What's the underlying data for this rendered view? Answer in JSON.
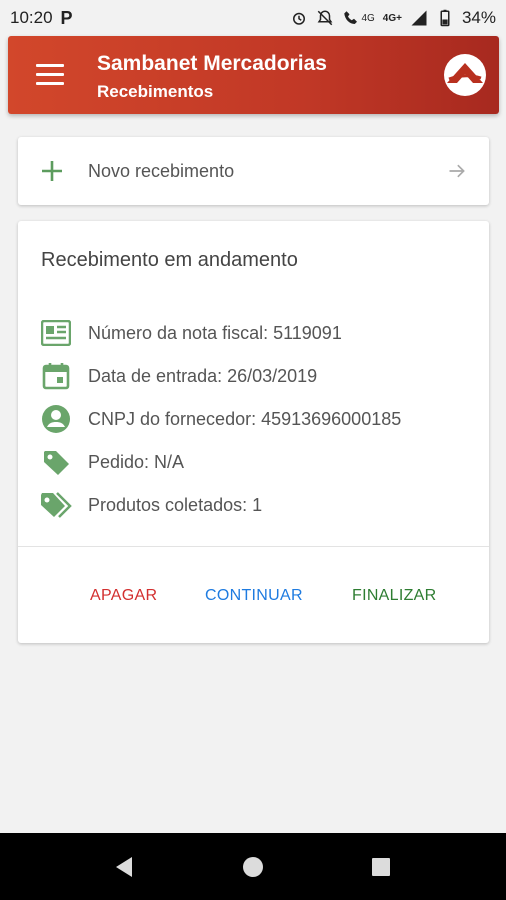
{
  "status": {
    "time": "10:20",
    "app_glyph": "P",
    "network_label": "4G+",
    "network_small": "4G",
    "battery": "34%"
  },
  "appbar": {
    "title": "Sambanet Mercadorias",
    "subtitle": "Recebimentos"
  },
  "new_card": {
    "label": "Novo recebimento"
  },
  "receipt": {
    "title": "Recebimento em andamento",
    "fields": [
      {
        "icon": "newspaper-icon",
        "text": "Número da nota fiscal: 5119091"
      },
      {
        "icon": "calendar-icon",
        "text": "Data de entrada: 26/03/2019"
      },
      {
        "icon": "account-circle-icon",
        "text": "CNPJ do fornecedor: 45913696000185"
      },
      {
        "icon": "tag-icon",
        "text": "Pedido: N/A"
      },
      {
        "icon": "tags-icon",
        "text": "Produtos coletados: 1"
      }
    ],
    "actions": {
      "delete": "APAGAR",
      "continue": "CONTINUAR",
      "finish": "FINALIZAR"
    }
  },
  "colors": {
    "primary": "#c13826",
    "icon_green": "#6aa56b",
    "delete": "#d32f2f",
    "continue": "#1e7be0",
    "finish": "#2e7d32"
  }
}
